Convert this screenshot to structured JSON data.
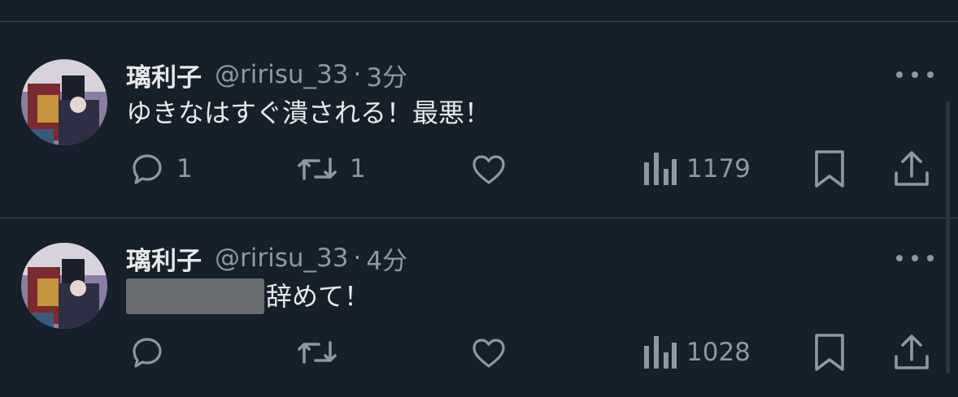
{
  "tweets": [
    {
      "author_name": "璃利子",
      "handle": "@ririsu_33",
      "separator": "·",
      "time": "3分",
      "text": "ゆきなはすぐ潰される！最悪！",
      "redacted_prefix": false,
      "reply_count": "1",
      "retweet_count": "1",
      "like_count": "",
      "views_count": "1179"
    },
    {
      "author_name": "璃利子",
      "handle": "@ririsu_33",
      "separator": "·",
      "time": "4分",
      "text": "辞めて！",
      "redacted_prefix": true,
      "reply_count": "",
      "retweet_count": "",
      "like_count": "",
      "views_count": "1028"
    }
  ],
  "icons": {
    "reply": "reply-icon",
    "retweet": "retweet-icon",
    "like": "heart-icon",
    "views": "analytics-icon",
    "bookmark": "bookmark-icon",
    "share": "share-icon",
    "more": "more-icon"
  },
  "colors": {
    "background": "#15202b",
    "primary_text": "#e7e9ea",
    "secondary_text": "#8b98a5",
    "divider": "#38444d"
  }
}
